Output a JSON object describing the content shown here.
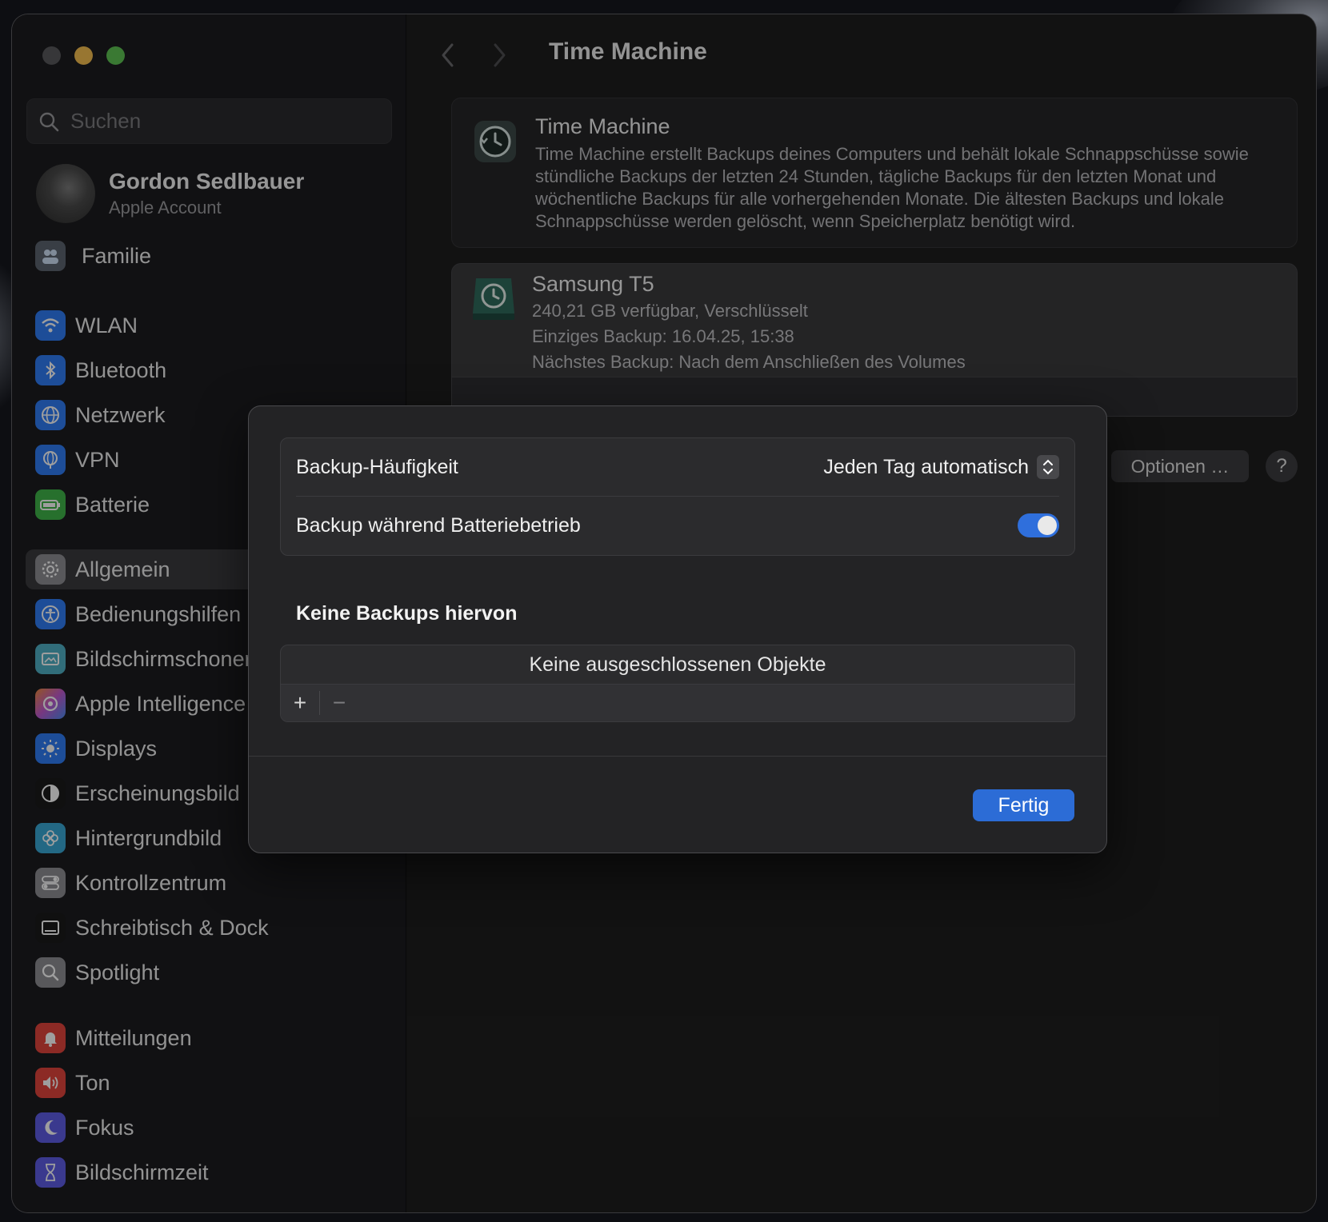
{
  "window": {
    "title": "Time Machine"
  },
  "sidebar": {
    "search_placeholder": "Suchen",
    "account": {
      "name": "Gordon Sedlbauer",
      "subtitle": "Apple Account"
    },
    "items": [
      {
        "label": "Familie",
        "icon": "family-icon",
        "color": "#6a6f78"
      },
      {
        "label": "WLAN",
        "icon": "wifi-icon",
        "color": "#2f7cf6"
      },
      {
        "label": "Bluetooth",
        "icon": "bluetooth-icon",
        "color": "#2f7cf6"
      },
      {
        "label": "Netzwerk",
        "icon": "globe-icon",
        "color": "#2f7cf6"
      },
      {
        "label": "VPN",
        "icon": "vpn-globe-icon",
        "color": "#2f7cf6"
      },
      {
        "label": "Batterie",
        "icon": "battery-icon",
        "color": "#3fb54a"
      },
      {
        "label": "Allgemein",
        "icon": "gear-icon",
        "color": "#8e8e93"
      },
      {
        "label": "Bedienungshilfen",
        "icon": "accessibility-icon",
        "color": "#2f7cf6"
      },
      {
        "label": "Bildschirmschoner",
        "icon": "screensaver-icon",
        "color": "#4fb0c6"
      },
      {
        "label": "Apple Intelligence & Siri",
        "icon": "apple-intelligence-icon",
        "color": "#c05ad0"
      },
      {
        "label": "Displays",
        "icon": "sun-icon",
        "color": "#2f7cf6"
      },
      {
        "label": "Erscheinungsbild",
        "icon": "appearance-icon",
        "color": "#1a1a1a"
      },
      {
        "label": "Hintergrundbild",
        "icon": "wallpaper-icon",
        "color": "#39a8d6"
      },
      {
        "label": "Kontrollzentrum",
        "icon": "control-center-icon",
        "color": "#8e8e93"
      },
      {
        "label": "Schreibtisch & Dock",
        "icon": "dock-icon",
        "color": "#1a1a1a"
      },
      {
        "label": "Spotlight",
        "icon": "spotlight-icon",
        "color": "#8e8e93"
      },
      {
        "label": "Mitteilungen",
        "icon": "notifications-icon",
        "color": "#e2453c"
      },
      {
        "label": "Ton",
        "icon": "sound-icon",
        "color": "#e2453c"
      },
      {
        "label": "Fokus",
        "icon": "moon-icon",
        "color": "#5e5ce6"
      },
      {
        "label": "Bildschirmzeit",
        "icon": "hourglass-icon",
        "color": "#5e5ce6"
      }
    ]
  },
  "main": {
    "title": "Time Machine",
    "info_card": {
      "title": "Time Machine",
      "description": "Time Machine erstellt Backups deines Computers und behält lokale Schnappschüsse sowie stündliche Backups der letzten 24 Stunden, tägliche Backups für den letzten Monat und wöchentliche Backups für alle vorhergehenden Monate. Die ältesten Backups und lokale Schnappschüsse werden gelöscht, wenn Speicherplatz benötigt wird."
    },
    "disk": {
      "name": "Samsung T5",
      "line1": "240,21 GB verfügbar, Verschlüsselt",
      "line2": "Einziges Backup: 16.04.25, 15:38",
      "line3": "Nächstes Backup: Nach dem Anschließen des Volumes"
    },
    "options_label": "Optionen …",
    "help_label": "?"
  },
  "sheet": {
    "frequency_label": "Backup-Häufigkeit",
    "frequency_value": "Jeden Tag automatisch",
    "battery_label": "Backup während Batteriebetrieb",
    "battery_enabled": true,
    "exclusions_title": "Keine Backups hiervon",
    "exclusions_empty": "Keine ausgeschlossenen Objekte",
    "add_label": "+",
    "remove_label": "−",
    "done_label": "Fertig"
  },
  "colors": {
    "accent": "#2c6cd6",
    "toggle_on": "#2f6fdc"
  }
}
